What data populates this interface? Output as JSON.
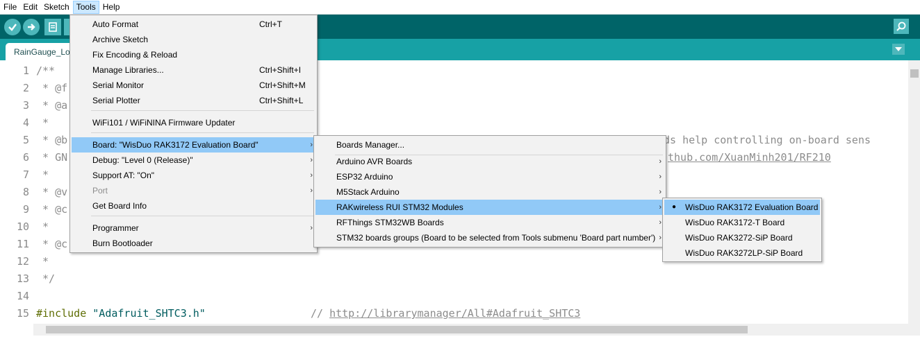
{
  "menubar": {
    "items": [
      {
        "label": "File"
      },
      {
        "label": "Edit"
      },
      {
        "label": "Sketch"
      },
      {
        "label": "Tools"
      },
      {
        "label": "Help"
      }
    ]
  },
  "toolbar": {
    "verify_icon": "check-icon",
    "upload_icon": "arrow-right-icon",
    "new_icon": "file-icon",
    "serial_monitor_icon": "magnifier-icon"
  },
  "tabs": [
    {
      "label": "RainGauge_Lo"
    }
  ],
  "editor": {
    "line_numbers": [
      "1",
      "2",
      "3",
      "4",
      "5",
      "6",
      "7",
      "8",
      "9",
      "10",
      "11",
      "12",
      "13",
      "14",
      "15"
    ],
    "lines": [
      "/**",
      " * @f",
      " * @a",
      " *",
      " * @b",
      " * GN",
      " *",
      " * @v",
      " * @c",
      " *",
      " * @c",
      " *",
      " */",
      "",
      ""
    ],
    "fragment_line5": "ds help controlling on-board sens",
    "fragment_line6": "thub.com/XuanMinh201/RF210",
    "include_kw": "#include",
    "include_str": "\"Adafruit_SHTC3.h\"",
    "include_comment": "//",
    "include_url": "http://librarymanager/All#Adafruit_SHTC3"
  },
  "tools_menu": {
    "items": [
      {
        "label": "Auto Format",
        "shortcut": "Ctrl+T"
      },
      {
        "label": "Archive Sketch",
        "shortcut": ""
      },
      {
        "label": "Fix Encoding & Reload",
        "shortcut": ""
      },
      {
        "label": "Manage Libraries...",
        "shortcut": "Ctrl+Shift+I"
      },
      {
        "label": "Serial Monitor",
        "shortcut": "Ctrl+Shift+M"
      },
      {
        "label": "Serial Plotter",
        "shortcut": "Ctrl+Shift+L"
      },
      {
        "label": "WiFi101 / WiFiNINA Firmware Updater",
        "shortcut": ""
      },
      {
        "label": "Board: \"WisDuo RAK3172 Evaluation Board\"",
        "shortcut": ""
      },
      {
        "label": "Debug: \"Level 0 (Release)\"",
        "shortcut": ""
      },
      {
        "label": "Support AT: \"On\"",
        "shortcut": ""
      },
      {
        "label": "Port",
        "shortcut": ""
      },
      {
        "label": "Get Board Info",
        "shortcut": ""
      },
      {
        "label": "Programmer",
        "shortcut": ""
      },
      {
        "label": "Burn Bootloader",
        "shortcut": ""
      }
    ]
  },
  "boards_menu": {
    "items": [
      {
        "label": "Boards Manager..."
      },
      {
        "label": "Arduino AVR Boards"
      },
      {
        "label": "ESP32 Arduino"
      },
      {
        "label": "M5Stack Arduino"
      },
      {
        "label": "RAKwireless RUI STM32 Modules"
      },
      {
        "label": "RFThings STM32WB Boards"
      },
      {
        "label": "STM32 boards groups (Board to be selected from Tools submenu 'Board part number')"
      }
    ]
  },
  "rak_menu": {
    "items": [
      {
        "label": "WisDuo RAK3172 Evaluation Board",
        "selected": true
      },
      {
        "label": "WisDuo RAK3172-T Board",
        "selected": false
      },
      {
        "label": "WisDuo RAK3272-SiP Board",
        "selected": false
      },
      {
        "label": "WisDuo RAK3272LP-SiP Board",
        "selected": false
      }
    ]
  },
  "glyphs": {
    "arrow": "›",
    "bullet": "●"
  },
  "colors": {
    "toolbar": "#006468",
    "tabbar": "#17a1a5",
    "button": "#4db7bb",
    "menu_highlight": "#91c9f7"
  }
}
